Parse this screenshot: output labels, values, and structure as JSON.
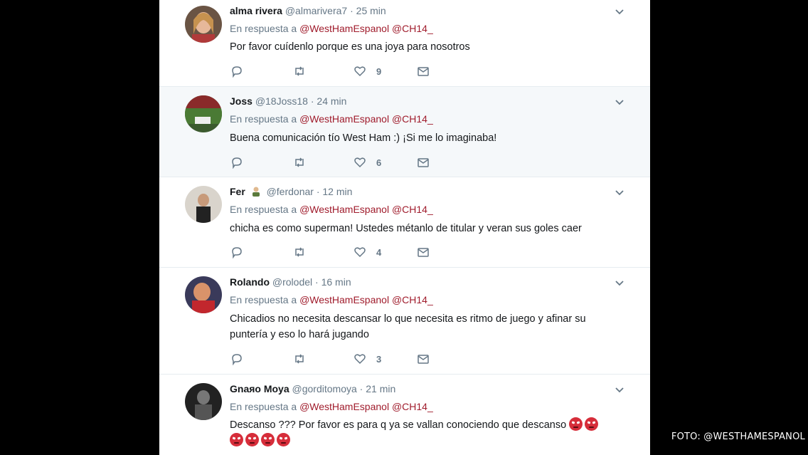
{
  "watermark": "FOTO: @WESTHAMESPANOL",
  "reply_prefix": "En respuesta a",
  "mentions": [
    "@WestHamEspanol",
    "@CH14_"
  ],
  "colors": {
    "mention": "#a01c2c",
    "highlight_bg": "#f5f8fa",
    "muted": "#657786"
  },
  "tweets": [
    {
      "name": "alma rivera",
      "handle": "@almarivera7",
      "time": "25 min",
      "emoji": "",
      "text": "Por favor cuídenlo porque es una joya para nosotros",
      "text2": "",
      "likes": "9"
    },
    {
      "name": "Joss",
      "handle": "@18Joss18",
      "time": "24 min",
      "emoji": "",
      "text": "Buena comunicación tío West Ham :) ¡Si me lo imaginaba!",
      "text2": "",
      "likes": "6"
    },
    {
      "name": "Fer",
      "handle": "@ferdonar",
      "time": "12 min",
      "emoji": "person-emoji",
      "text": "chicha es como superman! Ustedes métanlo de titular y veran sus goles caer",
      "text2": "",
      "likes": "4"
    },
    {
      "name": "Rolando",
      "handle": "@rolodel",
      "time": "16 min",
      "emoji": "",
      "text": "Chicadios no necesita descansar lo que necesita es ritmo de juego y afinar su",
      "text2": "puntería y eso lo hará jugando",
      "likes": "3"
    },
    {
      "name": "Gnaяo Moya",
      "handle": "@gorditomoya",
      "time": "21 min",
      "emoji": "",
      "text": "Descanso ??? Por favor es para q ya se vallan conociendo que descanso",
      "text2": "",
      "likes": ""
    }
  ]
}
